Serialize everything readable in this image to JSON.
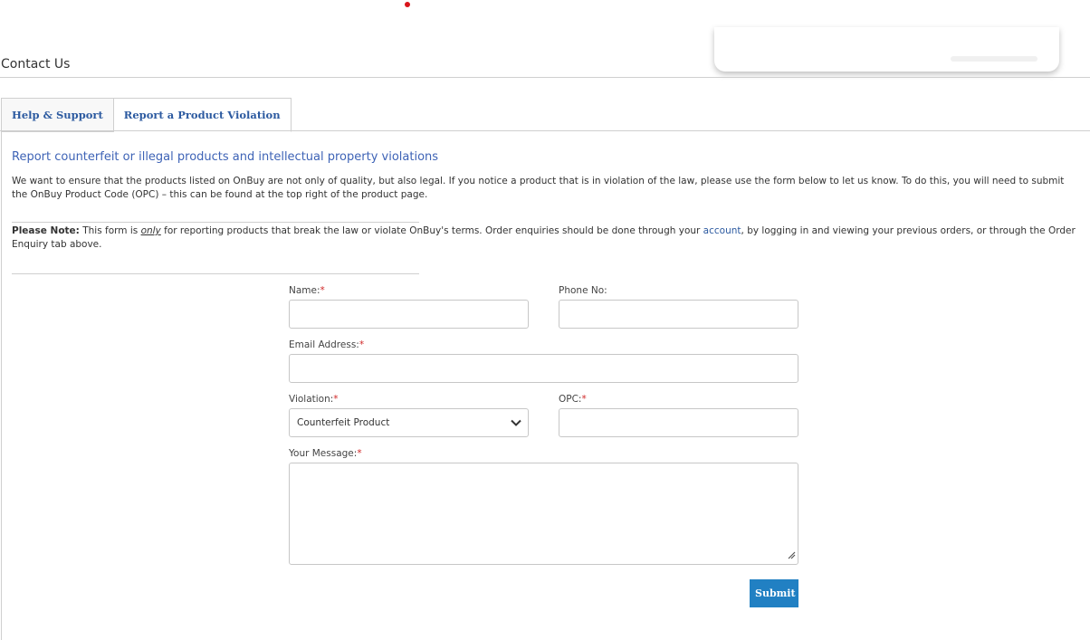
{
  "page": {
    "title": "Contact Us"
  },
  "tabs": [
    {
      "label": "Help & Support"
    },
    {
      "label": "Report a Product Violation"
    }
  ],
  "content": {
    "heading": "Report counterfeit or illegal products and intellectual property violations",
    "intro": "We want to ensure that the products listed on OnBuy are not only of quality, but also legal. If you notice a product that is in violation of the law, please use the form below to let us know. To do this, you will need to submit the OnBuy Product Code (OPC) – this can be found at the top right of the product page.",
    "note_label": "Please Note:",
    "note_1": " This form is ",
    "note_only": "only",
    "note_2": " for reporting products that break the law or violate OnBuy's terms. Order enquiries should be done through your ",
    "note_link": "account",
    "note_3": ", by logging in and viewing your previous orders, or through the Order Enquiry tab above."
  },
  "form": {
    "name_label": "Name:",
    "phone_label": "Phone No:",
    "email_label": "Email Address:",
    "violation_label": "Violation:",
    "violation_value": "Counterfeit Product",
    "opc_label": "OPC:",
    "message_label": "Your Message:",
    "required_mark": "*",
    "submit_label": "Submit"
  },
  "colors": {
    "accent": "#2180c3",
    "link": "#2c5aa0",
    "heading": "#3e63b6",
    "required": "#d02727"
  }
}
